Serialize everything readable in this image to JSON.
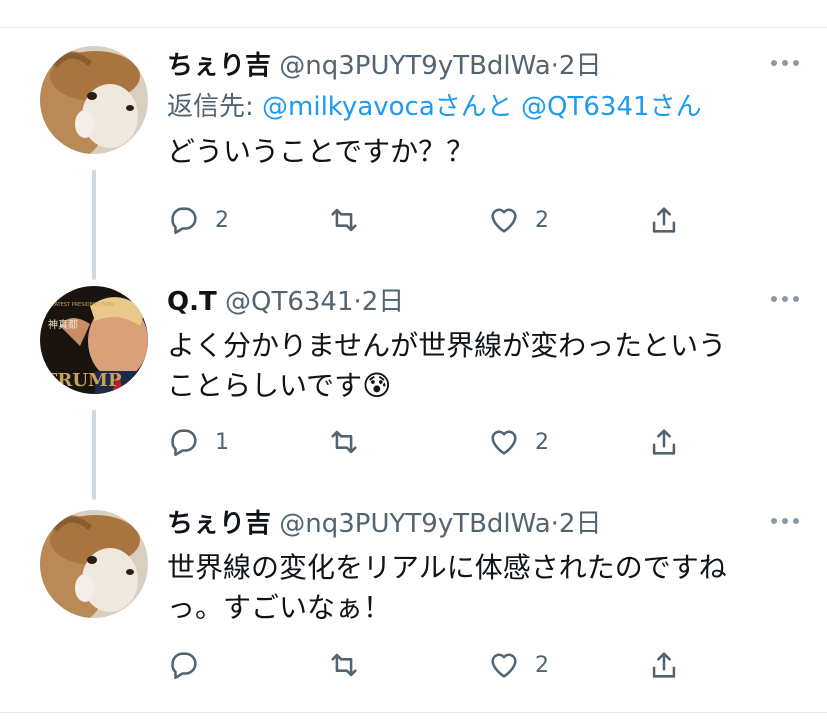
{
  "tweets": [
    {
      "display_name": "ちぇり吉",
      "handle": "@nq3PUYT9yTBdlWa",
      "time": "2日",
      "reply_to_prefix": "返信先: ",
      "reply_to_user1": "@milkyavoca",
      "reply_to_mid": "さんと ",
      "reply_to_user2": "@QT6341",
      "reply_to_suffix": "さん",
      "text": "どういうことですか？？",
      "replies": "2",
      "retweets": "",
      "likes": "2",
      "avatar": "dog-photo"
    },
    {
      "display_name": "Q.T",
      "handle": "@QT6341",
      "time": "2日",
      "text": "よく分かりませんが世界線が変わったという\nことらしいです",
      "emoji": "😰",
      "replies": "1",
      "retweets": "",
      "likes": "2",
      "avatar_text_top": "GREATEST PRESIDENT EVER",
      "avatar_kanji": "神真都",
      "avatar_text_bottom": "TRUMP",
      "avatar_colors": {
        "bg": "#1a1410",
        "gold": "#c9a25a"
      }
    },
    {
      "display_name": "ちぇり吉",
      "handle": "@nq3PUYT9yTBdlWa",
      "time": "2日",
      "text": "世界線の変化をリアルに体感されたのですね\nっ。すごいなぁ！",
      "replies": "",
      "retweets": "",
      "likes": "2",
      "avatar": "dog-photo"
    }
  ],
  "separator": "·",
  "colors": {
    "text": "#0f1419",
    "secondary": "#536471",
    "link": "#1d9bf0",
    "thread_line": "#cfd9de"
  }
}
